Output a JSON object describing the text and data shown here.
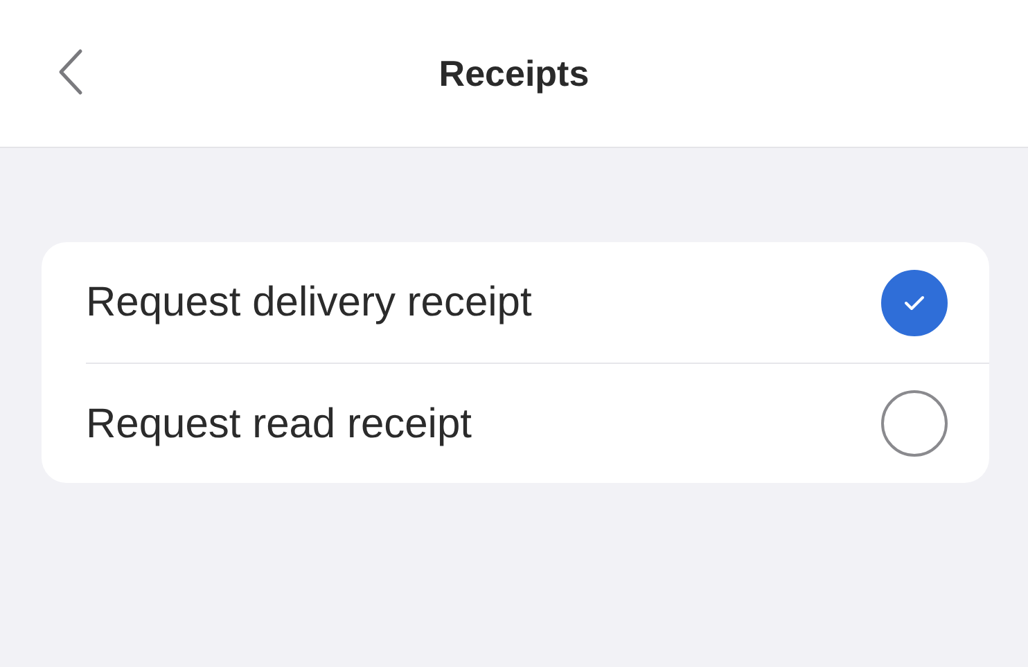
{
  "header": {
    "title": "Receipts"
  },
  "options": [
    {
      "label": "Request delivery receipt",
      "selected": true
    },
    {
      "label": "Request read receipt",
      "selected": false
    }
  ]
}
